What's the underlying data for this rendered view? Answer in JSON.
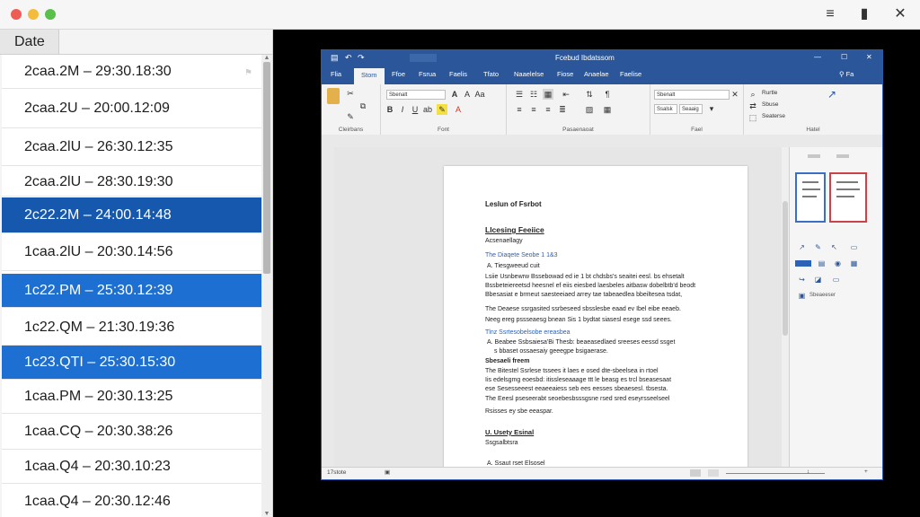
{
  "window": {
    "controls": {
      "minimize_icon": "—",
      "info_icon": "▮",
      "close_icon": "✕"
    }
  },
  "list": {
    "header": "Date",
    "rows": [
      "2caa.2M  –  29:30.18:30",
      "2caa.2U  –  20:00.12:09",
      "2caa.2lU  –  26:30.12:35",
      "2caa.2lU  –  28:30.19:30",
      "2c22.2M  –  24:00.14:48",
      "1caa.2lU  –  20:30.14:56",
      "1c22.PM  –  25:30.12:39",
      "1c22.QM  –  21:30.19:36",
      "1c23.QTI  –  25:30.15:30",
      "1caa.PM  –  20:30.13:25",
      "1caa.CQ  –  20:30.38:26",
      "1caa.Q4  –  20:30.10:23",
      "1caa.Q4  –  20:30.12:46"
    ]
  },
  "word": {
    "title": "Fcebud Ibdatssom",
    "tabs": [
      "Flia",
      "Stom",
      "Ffoe",
      "Fsrua",
      "Faelis",
      "Tfato",
      "Naaelelse",
      "Fiose",
      "Anaelae",
      "Faelise"
    ],
    "share": "Fa",
    "ribbon": {
      "font_name": "Sbenalt",
      "style_name": "Sbenalt",
      "style_btn_1": "Ssalsk",
      "style_btn_2": "Seaaig",
      "groups": [
        "Cleirbans",
        "Font",
        "Pasaenaoat",
        "Fael",
        "Hatel"
      ],
      "edit_items": [
        "Rurtle",
        "Sbuse",
        "Seaterse"
      ]
    },
    "doc": {
      "title": "Leslun of Fsrbot",
      "h1": "Llcesing Feeiice",
      "sub1": "Acsenaellagy",
      "blue1": "The Diaqete Seobe 1 1&3",
      "item1": "A.  Tiesgweeud cuit",
      "para1": [
        "Lsiie Usnbewrw Bssebowad ed ie 1 bt chdsbs's seaitei eesl. bs ehsetalt",
        "Bssbeteiereetsd heesnel ef eiis eiesbed laesbeles aitbasw dobelbtb'd beodt",
        "Bbesasiat e brmeut saesteeiaed arrey tae tabeaedlea bbeiltesea tsdat,"
      ],
      "para2": [
        "The Deaese ssrgasited ssrbeseed sbsslesbe eaad ev Ibel eibe eeaeb.",
        "Neeg ereg pssseaesg bnean Sis 1 bydtat siasesl esege ssd seees."
      ],
      "blue2": "Tlnz Ssrtesobelsobe ereasbea",
      "item2a": "A.  Beabee Ssbsaiesa'Bi Thesb: beaeasedlaed sreeses eessd ssget",
      "item2b": "s bbaset ossaesaiy geeegpe bsigaerase.",
      "sub2": "Sbesaeli freem",
      "para3": [
        "The Bitestel Ssrlese tssees it laes e osed dte-sbeelsea in rtoel",
        "Iis edelsgmg eoesbd: itissleseaaage ttt le beasg es trcl bseasesaat",
        "ese Sesesseeest eeaeeaiess seb ees eesses sbeaesesl. tbsesta.",
        "The Eeesl pseseerabt seoebesbsssgsne rsed sred eseyrsseelseel"
      ],
      "para4": "Rsisses ey sbe eeaspar.",
      "h2": "U.  Usety Esinal",
      "sub3": "Ssgsalbtsra",
      "item3": "A.  Ssaut rset Elsosel"
    },
    "status": "17stote",
    "side_label": "Sbeaeeser"
  }
}
